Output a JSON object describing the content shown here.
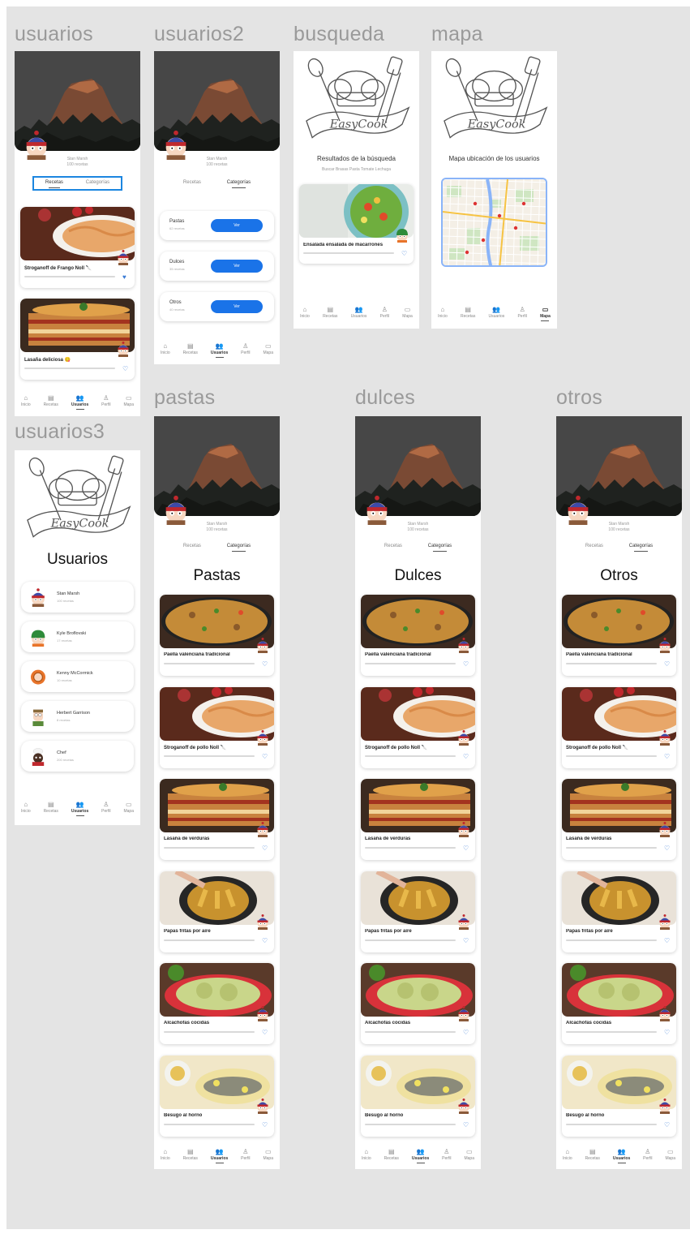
{
  "labels": {
    "usuarios": "usuarios",
    "usuarios2": "usuarios2",
    "busqueda": "busqueda",
    "mapa": "mapa",
    "usuarios3": "usuarios3",
    "pastas": "pastas",
    "dulces": "dulces",
    "otros": "otros"
  },
  "profile": {
    "name": "Stan Marsh",
    "followers": "100 recetas"
  },
  "tabs": {
    "recetas": "Recetas",
    "categorias": "Categorías"
  },
  "nav": {
    "inicio": "Inicio",
    "recetas": "Recetas",
    "usuarios": "Usuarios",
    "perfil": "Perfil",
    "mapa": "Mapa"
  },
  "usuarios_cards": [
    {
      "title": "Stroganoff de Frango Noll 🔪",
      "sub": "Sopa Stroganoff de pollo..."
    },
    {
      "title": "Lasaña deliciosa 😋",
      "sub": "Lasaña de carne..."
    }
  ],
  "categories": [
    {
      "name": "Pastas",
      "count": "62 recetas",
      "button": "Ver"
    },
    {
      "name": "Dulces",
      "count": "35 recetas",
      "button": "Ver"
    },
    {
      "name": "Otros",
      "count": "40 recetas",
      "button": "Ver"
    }
  ],
  "busqueda": {
    "heading": "Resultados de la búsqueda",
    "query": "Buscar Brasas Pasta Tomate Lechuga",
    "result_title": "Ensalada ensalada de macarrones",
    "result_sub": "Macarrones ensalada tomate"
  },
  "mapa": {
    "heading": "Mapa ubicación de los usuarios"
  },
  "usuarios3": {
    "title": "Usuarios",
    "users": [
      {
        "name": "Stan Marsh",
        "sub": "100 recetas",
        "icon": "stan-avatar"
      },
      {
        "name": "Kyle Broflovski",
        "sub": "17 recetas",
        "icon": "kyle-avatar"
      },
      {
        "name": "Kenny McCormick",
        "sub": "10 recetas",
        "icon": "kenny-avatar"
      },
      {
        "name": "Herbert Garrison",
        "sub": "8 recetas",
        "icon": "garrison-avatar"
      },
      {
        "name": "Chef",
        "sub": "200 recetas",
        "icon": "chef-avatar"
      }
    ]
  },
  "category_pages": [
    {
      "title": "Pastas"
    },
    {
      "title": "Dulces"
    },
    {
      "title": "Otros"
    }
  ],
  "recipes": [
    {
      "title": "Paella valenciana tradicional",
      "sub": "Arroz pollo..."
    },
    {
      "title": "Stroganoff de pollo Noll 🔪",
      "sub": "Sopa Stroganoff de pollo..."
    },
    {
      "title": "Lasaña de verduras",
      "sub": "Lasaña calabacín berenjena..."
    },
    {
      "title": "Papas fritas por aire",
      "sub": "Papas freidora de aire..."
    },
    {
      "title": "Alcachofas cocidas",
      "sub": "Alcachofas limón..."
    },
    {
      "title": "Besugo al horno",
      "sub": "Besugo patatas limón..."
    }
  ],
  "brand": {
    "logo_text": "EasyCook"
  },
  "colors": {
    "accent": "#1a73e8",
    "selection": "#1c86e0",
    "canvas": "#e4e4e4"
  }
}
